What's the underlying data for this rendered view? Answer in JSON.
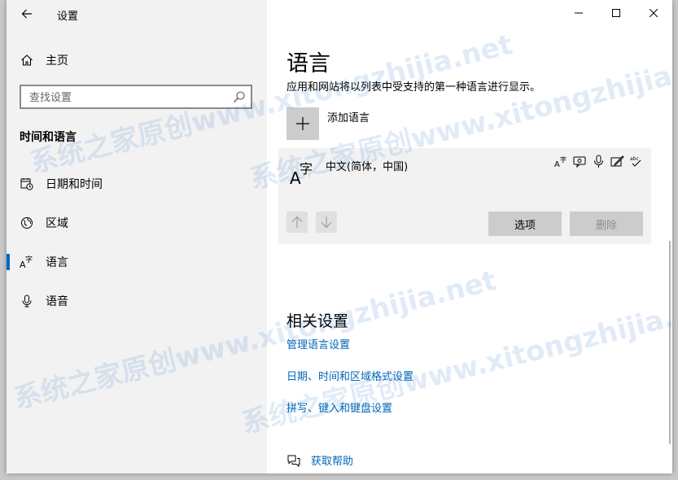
{
  "window": {
    "title": "设置"
  },
  "sidebar": {
    "home_label": "主页",
    "search_placeholder": "查找设置",
    "section_heading": "时间和语言",
    "items": [
      {
        "label": "日期和时间",
        "icon": "calendar-clock-icon"
      },
      {
        "label": "区域",
        "icon": "globe-icon"
      },
      {
        "label": "语言",
        "icon": "language-icon",
        "selected": true
      },
      {
        "label": "语音",
        "icon": "microphone-icon"
      }
    ]
  },
  "main": {
    "title": "语言",
    "description": "应用和网站将以列表中受支持的第一种语言进行显示。",
    "add_language_label": "添加语言",
    "language_card": {
      "language_name": "中文(简体，中国)",
      "options_label": "选项",
      "remove_label": "删除"
    },
    "related": {
      "heading": "相关设置",
      "links": [
        "管理语言设置",
        "日期、时间和区域格式设置",
        "拼写、键入和键盘设置"
      ]
    },
    "help_label": "获取帮助"
  },
  "watermark": {
    "text": "系统之家原创www.xitongzhijia.net"
  },
  "colors": {
    "accent": "#0067c0",
    "link": "#0067b8",
    "sidebar_bg": "#f2f2f2",
    "card_bg": "#f2f2f2"
  }
}
